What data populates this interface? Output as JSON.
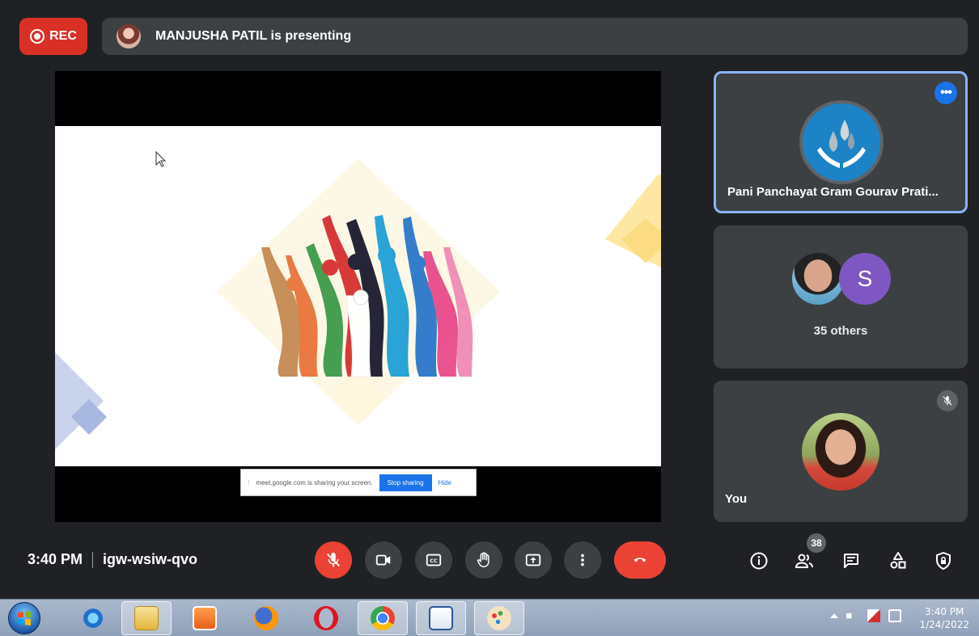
{
  "top": {
    "rec_label": "REC",
    "presenting_text": "MANJUSHA PATIL is presenting"
  },
  "share_notice": {
    "text": "meet.google.com is sharing your screen.",
    "stop_label": "Stop sharing",
    "hide_label": "Hide"
  },
  "tiles": {
    "pinned_name": "Pani Panchayat Gram Gourav Prati...",
    "others_initial": "S",
    "others_label": "35 others",
    "self_label": "You"
  },
  "bottom": {
    "time": "3:40 PM",
    "meeting_code": "igw-wsiw-qvo",
    "participants_count": "38"
  },
  "taskbar": {
    "clock_time": "3:40 PM",
    "clock_date": "1/24/2022",
    "apps": [
      "internet-explorer-icon",
      "file-explorer-icon",
      "media-player-icon",
      "firefox-icon",
      "opera-icon",
      "chrome-icon",
      "word-icon",
      "paint-icon"
    ]
  },
  "colors": {
    "rec_red": "#d93025",
    "end_call_red": "#ea4335",
    "active_tile_border": "#8ab4f8",
    "avatar_purple": "#7e57c2",
    "background": "#202124",
    "tile_bg": "#3c4043"
  }
}
